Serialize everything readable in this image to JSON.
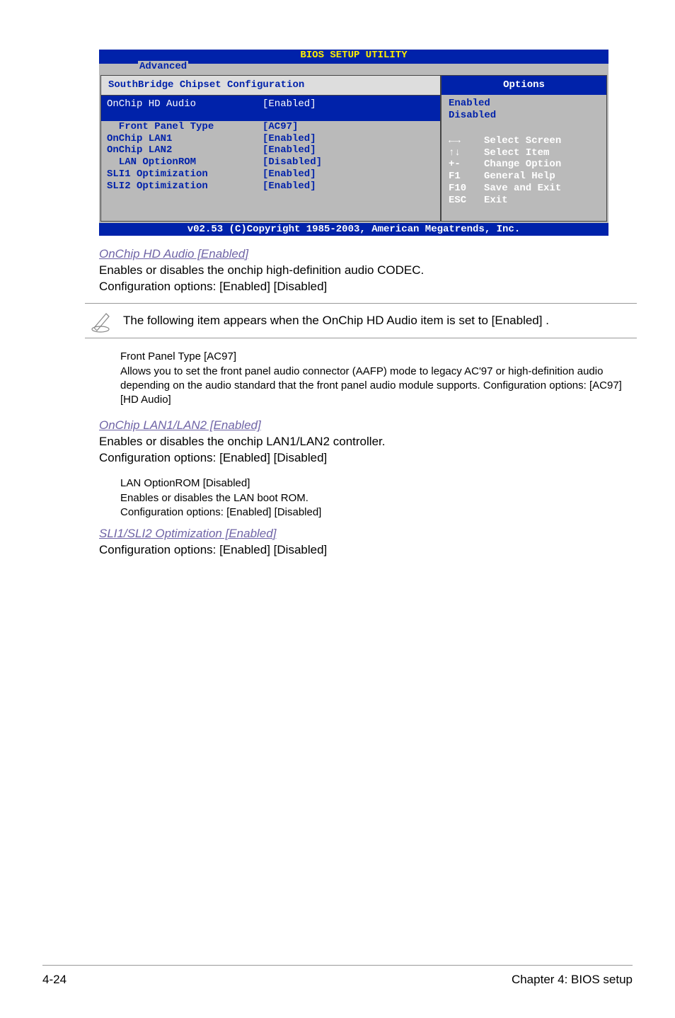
{
  "bios": {
    "title": "BIOS SETUP UTILITY",
    "tab": "Advanced",
    "left_title": "SouthBridge Chipset Configuration",
    "items": [
      {
        "label": "OnChip HD Audio",
        "value": "[Enabled]",
        "highlight": true,
        "indent": 0
      },
      {
        "label": "Front Panel Type",
        "value": "[AC97]",
        "highlight": false,
        "indent": 2
      },
      {
        "label": "OnChip LAN1",
        "value": "[Enabled]",
        "highlight": false,
        "indent": 0
      },
      {
        "label": "OnChip LAN2",
        "value": "[Enabled]",
        "highlight": false,
        "indent": 0
      },
      {
        "label": "LAN OptionROM",
        "value": "[Disabled]",
        "highlight": false,
        "indent": 2
      },
      {
        "label": "",
        "value": "",
        "highlight": false,
        "indent": 0
      },
      {
        "label": "SLI1 Optimization",
        "value": "[Enabled]",
        "highlight": false,
        "indent": 0
      },
      {
        "label": "SLI2 Optimization",
        "value": "[Enabled]",
        "highlight": false,
        "indent": 0
      }
    ],
    "right_title": "Options",
    "options": [
      "Enabled",
      "Disabled"
    ],
    "help": [
      {
        "key": "←→",
        "value": "Select Screen"
      },
      {
        "key": "↑↓",
        "value": "Select Item"
      },
      {
        "key": "+-",
        "value": "Change Option"
      },
      {
        "key": "F1",
        "value": "General Help"
      },
      {
        "key": "F10",
        "value": "Save and Exit"
      },
      {
        "key": "ESC",
        "value": "Exit"
      }
    ],
    "footer": "v02.53 (C)Copyright 1985-2003, American Megatrends, Inc."
  },
  "doc": {
    "h1": "OnChip HD Audio [Enabled]",
    "p1a": "Enables or disables the onchip high-definition audio CODEC.",
    "p1b": "Configuration options: [Enabled] [Disabled]",
    "note": "The following item appears when the OnChip HD Audio item is set to [Enabled] .",
    "sub1_title": "Front Panel Type [AC97]",
    "sub1_body": "Allows you to set the front panel audio connector (AAFP) mode to legacy AC'97 or high-definition audio depending on the audio standard that the front panel audio module supports. Configuration options: [AC97] [HD Audio]",
    "h2": "OnChip LAN1/LAN2 [Enabled]",
    "p2a": "Enables or disables the onchip LAN1/LAN2 controller.",
    "p2b": "Configuration options: [Enabled] [Disabled]",
    "sub2_title": "LAN OptionROM [Disabled]",
    "sub2_body1": "Enables or disables the LAN boot ROM.",
    "sub2_body2": "Configuration options: [Enabled] [Disabled]",
    "h3": "SLI1/SLI2 Optimization [Enabled]",
    "p3": "Configuration options: [Enabled] [Disabled]"
  },
  "footer": {
    "left": "4-24",
    "right": "Chapter 4: BIOS setup"
  }
}
